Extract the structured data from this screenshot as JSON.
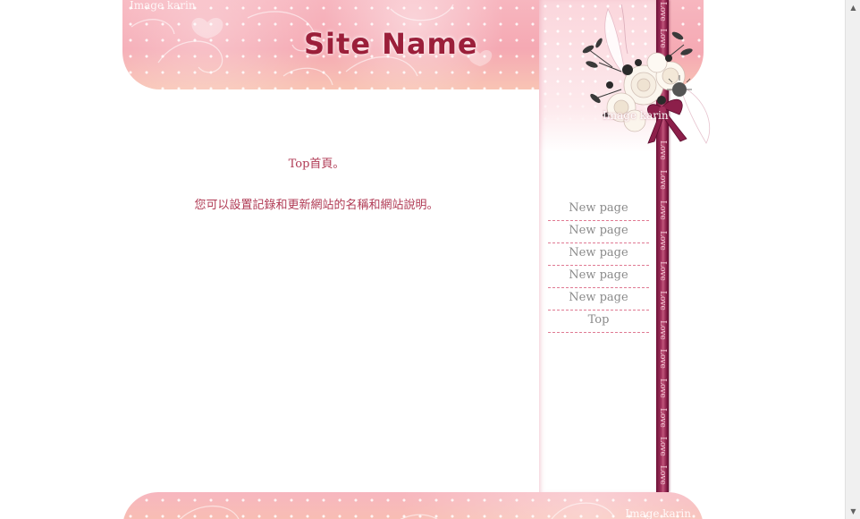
{
  "header": {
    "watermark": "Image karin",
    "site_name": "Site Name"
  },
  "bouquet": {
    "watermark": "Image karin"
  },
  "ribbon": {
    "text": "Love"
  },
  "nav": {
    "items": [
      {
        "label": "New page"
      },
      {
        "label": "New page"
      },
      {
        "label": "New page"
      },
      {
        "label": "New page"
      },
      {
        "label": "New page"
      },
      {
        "label": "Top"
      }
    ]
  },
  "main": {
    "title": "Top首頁。",
    "description": "您可以設置記錄和更新網站的名稱和網站說明。"
  },
  "footer": {
    "watermark": "Image karin"
  },
  "colors": {
    "accent": "#9b1f3a",
    "text": "#b03a54",
    "nav_text": "#8a8a8a",
    "pink": "#f5a9b3",
    "ribbon": "#8c1f4a"
  },
  "icons": {
    "scroll_up": "scroll-up-arrow-icon",
    "scroll_down": "scroll-down-arrow-icon"
  }
}
